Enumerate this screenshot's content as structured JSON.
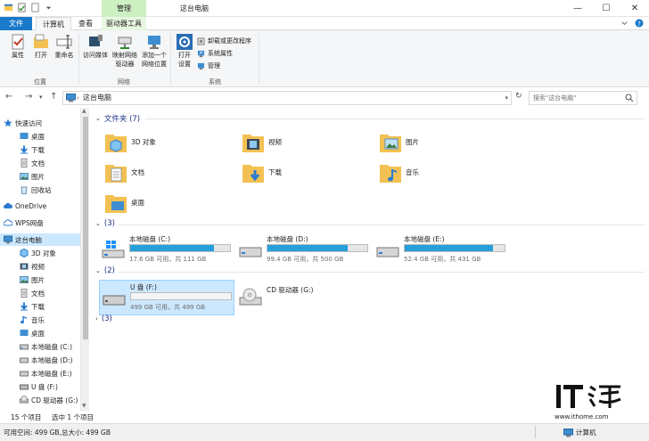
{
  "titlebar": {
    "context_tab": "管理",
    "title": "这台电脑",
    "minimize": "—",
    "maximize": "☐",
    "close": "✕"
  },
  "tabs": {
    "file": "文件",
    "computer": "计算机",
    "view": "查看",
    "drive_tools": "驱动器工具"
  },
  "ribbon": {
    "properties": "属性",
    "open": "打开",
    "rename": "重命名",
    "location_group": "位置",
    "access_media": "访问媒体",
    "map_drive_1": "映射网络",
    "map_drive_2": "驱动器",
    "add_location_1": "添加一个",
    "add_location_2": "网络位置",
    "network_group": "网络",
    "open_settings_1": "打开",
    "open_settings_2": "设置",
    "uninstall": "卸载或更改程序",
    "system_props": "系统属性",
    "manage": "管理",
    "system_group": "系统"
  },
  "nav": {
    "address": "这台电脑",
    "search_placeholder": "搜索\"这台电脑\""
  },
  "sidebar": {
    "items": [
      {
        "label": "快速访问"
      },
      {
        "label": "桌面"
      },
      {
        "label": "下载"
      },
      {
        "label": "文档"
      },
      {
        "label": "图片"
      },
      {
        "label": "回收站"
      },
      {
        "label": "OneDrive"
      },
      {
        "label": "WPS网盘"
      },
      {
        "label": "这台电脑"
      },
      {
        "label": "3D 对象"
      },
      {
        "label": "视频"
      },
      {
        "label": "图片"
      },
      {
        "label": "文档"
      },
      {
        "label": "下载"
      },
      {
        "label": "音乐"
      },
      {
        "label": "桌面"
      },
      {
        "label": "本地磁盘 (C:)"
      },
      {
        "label": "本地磁盘 (D:)"
      },
      {
        "label": "本地磁盘 (E:)"
      },
      {
        "label": "U 盘 (F:)"
      },
      {
        "label": "CD 驱动器 (G:)"
      }
    ]
  },
  "content": {
    "folders_header": "文件夹 (7)",
    "folders": [
      {
        "name": "3D 对象"
      },
      {
        "name": "视频"
      },
      {
        "name": "图片"
      },
      {
        "name": "文档"
      },
      {
        "name": "下载"
      },
      {
        "name": "音乐"
      },
      {
        "name": "桌面"
      }
    ],
    "group1_header": "(3)",
    "drives": [
      {
        "name": "本地磁盘 (C:)",
        "info": "17.6 GB 可用，共 111 GB",
        "used_fraction": 0.84
      },
      {
        "name": "本地磁盘 (D:)",
        "info": "99.4 GB 可用，共 500 GB",
        "used_fraction": 0.8
      },
      {
        "name": "本地磁盘 (E:)",
        "info": "52.4 GB 可用，共 431 GB",
        "used_fraction": 0.88
      }
    ],
    "group2_header": "(2)",
    "usb": {
      "name": "U 盘 (F:)",
      "info": "499 GB 可用，共 499 GB",
      "used_fraction": 0.0
    },
    "cd": {
      "name": "CD 驱动器 (G:)"
    },
    "group3_header": "(3)"
  },
  "status": {
    "items_count": "15 个项目",
    "selected": "选中 1 个项目"
  },
  "bottombar": {
    "info": "可用空间: 499 GB,总大小: 499 GB",
    "computer": "计算机"
  },
  "watermark": {
    "url": "www.ithome.com"
  },
  "colors": {
    "accent": "#1979ca",
    "selection": "#cce8ff",
    "drive_bar": "#26a0da",
    "context_tab": "#cdf0c2"
  }
}
